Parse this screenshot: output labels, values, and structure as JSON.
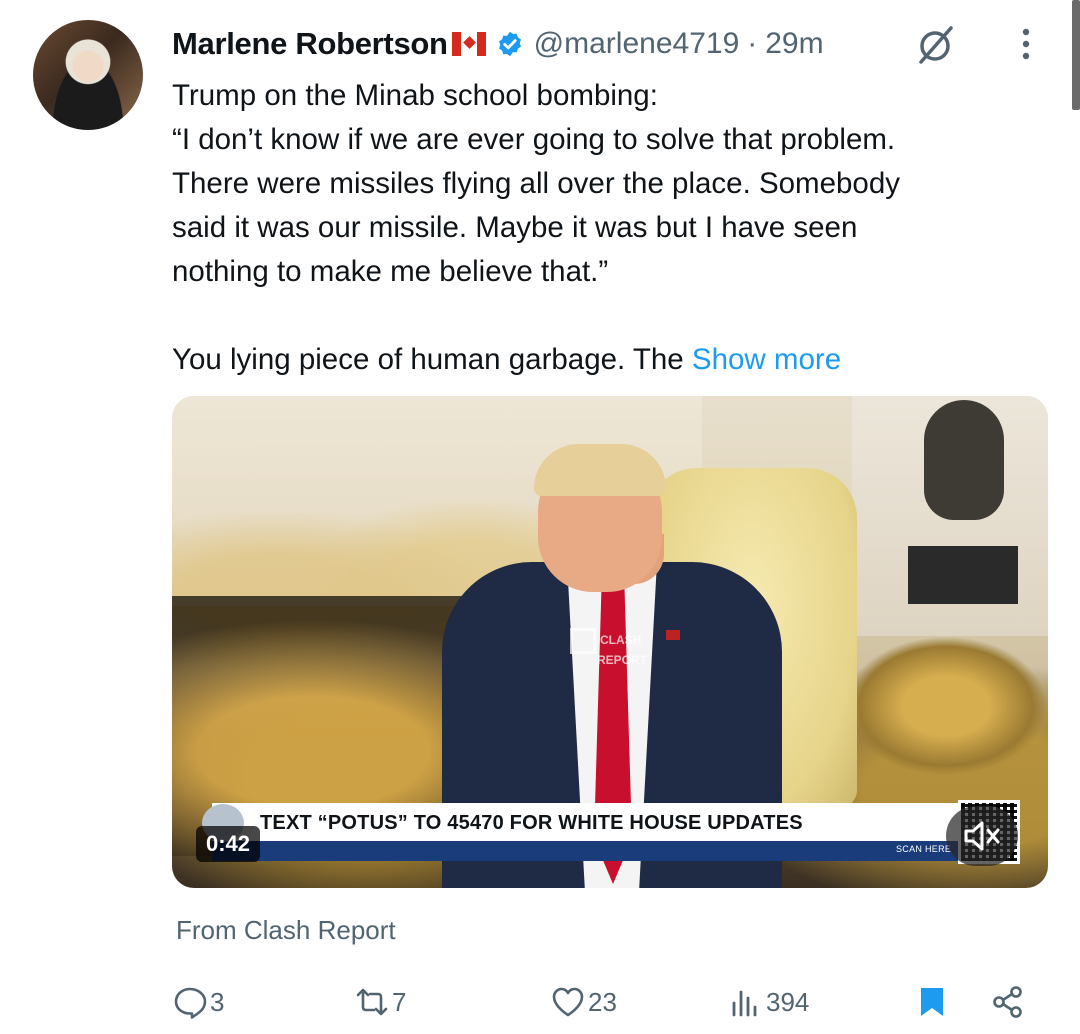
{
  "tweet": {
    "author": {
      "display_name": "Marlene Robertson",
      "flag_icon": "canada-flag-icon",
      "verified_icon": "verified-badge-icon",
      "handle": "@marlene4719",
      "separator": "·",
      "time": "29m"
    },
    "text_lines": [
      "Trump on the Minab school bombing:",
      "“I don’t know if we are ever going to solve that problem.",
      "There were missiles flying all over the place.  Somebody",
      "said it was our missile. Maybe it was but I have seen",
      "nothing to make me believe that.”",
      "",
      "You lying piece of human garbage.  The "
    ],
    "show_more": "Show more",
    "media": {
      "watermark_top": "CLASH",
      "watermark_bottom": "REPORT",
      "banner_text": "TEXT “POTUS” TO 45470 FOR WHITE HOUSE UPDATES",
      "scan_here": "SCAN HERE",
      "duration": "0:42"
    },
    "source": "From Clash Report",
    "actions": {
      "replies": "3",
      "reposts": "7",
      "likes": "23",
      "views": "394"
    }
  },
  "colors": {
    "accent": "#1d9bf0",
    "secondary_text": "#536471",
    "primary_text": "#0f1419",
    "bookmark_active": "#1d9bf0"
  }
}
